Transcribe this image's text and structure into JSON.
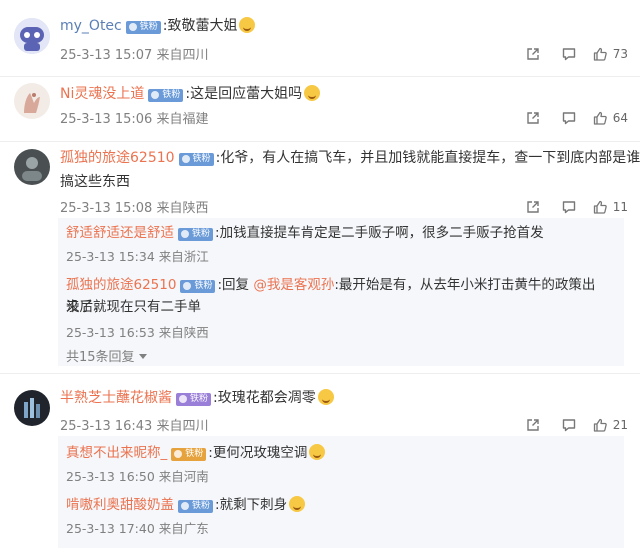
{
  "comments": [
    {
      "user": "my_Otec",
      "badge": "铁粉",
      "text": ":致敬蕾大姐",
      "date": "25-3-13 15:07",
      "location": "来自四川",
      "likes": "73"
    },
    {
      "user": "Ni灵魂没上道",
      "badge": "铁粉",
      "text": ":这是回应蕾大姐吗",
      "date": "25-3-13 15:06",
      "location": "来自福建",
      "likes": "64"
    },
    {
      "user": "孤独的旅途62510",
      "badge": "铁粉",
      "text": ":化爷，有人在搞飞车，并且加钱就能直接提车，查一下到底内部是谁在",
      "text2": "搞这些东西",
      "date": "25-3-13 15:08",
      "location": "来自陕西",
      "likes": "11",
      "replies": [
        {
          "user": "舒适舒适还是舒适",
          "badge": "铁粉",
          "text": ":加钱直接提车肯定是二手贩子啊，很多二手贩子抢首发",
          "date": "25-3-13 15:34",
          "location": "来自浙江"
        },
        {
          "user": "孤独的旅途62510",
          "badge": "铁粉",
          "prefix": ":回复",
          "mention": "@我是客观孙",
          "text": ":最开始是有，从去年小米打击黄牛的政策出来后就",
          "text2": "没了，现在只有二手单",
          "date": "25-3-13 16:53",
          "location": "来自陕西"
        }
      ],
      "more_replies": "共15条回复"
    },
    {
      "user": "半熟芝士蘸花椒酱",
      "badge": "铁粉",
      "text": ":玫瑰花都会凋零",
      "date": "25-3-13 16:43",
      "location": "来自四川",
      "likes": "21",
      "replies": [
        {
          "user": "真想不出来昵称_",
          "badge": "铁粉",
          "text": ":更何况玫瑰空调",
          "date": "25-3-13 16:50",
          "location": "来自河南"
        },
        {
          "user": "啃嗷利奥甜酸奶盖",
          "badge": "铁粉",
          "text": ":就剩下刺身",
          "date": "25-3-13 17:40",
          "location": "来自广东"
        }
      ]
    }
  ]
}
